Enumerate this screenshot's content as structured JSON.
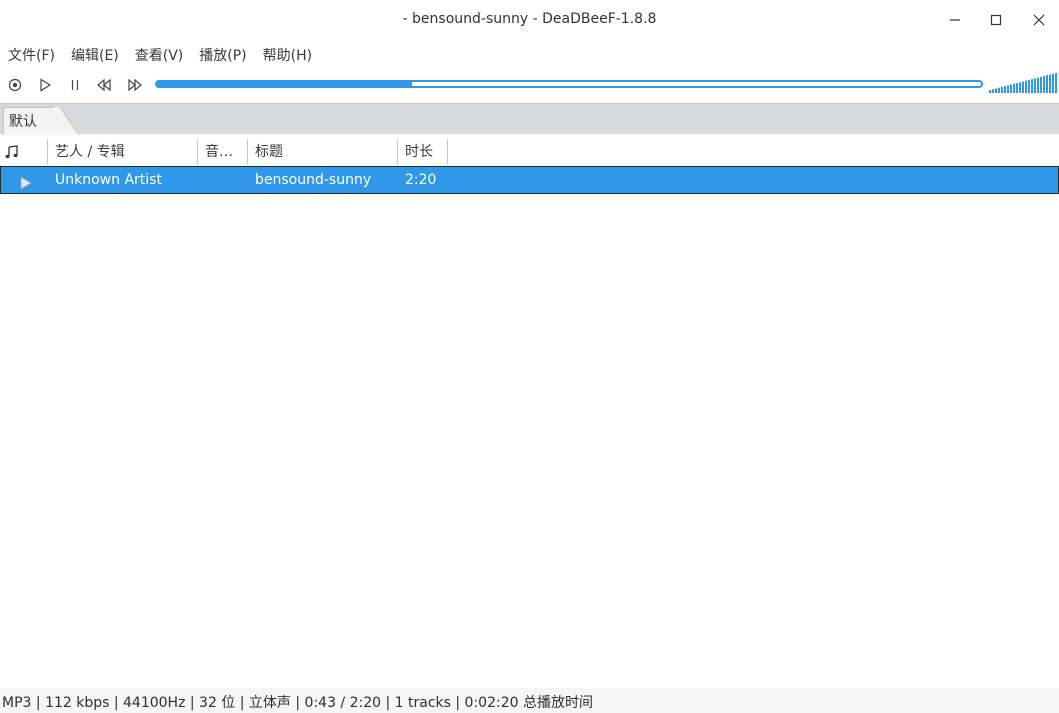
{
  "window": {
    "title": "- bensound-sunny - DeaDBeeF-1.8.8"
  },
  "menu": [
    {
      "label": "文件(F)"
    },
    {
      "label": "编辑(E)"
    },
    {
      "label": "查看(V)"
    },
    {
      "label": "播放(P)"
    },
    {
      "label": "帮助(H)"
    }
  ],
  "playback": {
    "progress_fraction": 0.31,
    "volume_fraction": 1.0
  },
  "tabs": [
    {
      "label": "默认"
    }
  ],
  "columns": [
    {
      "label": ""
    },
    {
      "label": "艺人 / 专辑"
    },
    {
      "label": "音…"
    },
    {
      "label": "标题"
    },
    {
      "label": "时长"
    }
  ],
  "tracks": [
    {
      "artist": "Unknown Artist",
      "title": "bensound-sunny",
      "duration": "2:20"
    }
  ],
  "status": {
    "text": "MP3 | 112 kbps | 44100Hz | 32 位 | 立体声 | 0:43 / 2:20 | 1 tracks | 0:02:20 总播放时间"
  },
  "colors": {
    "accent": "#2f98e8",
    "tabstrip": "#d7d9db"
  },
  "icons": [
    "stop-icon",
    "play-icon",
    "pause-icon",
    "previous-icon",
    "next-icon",
    "minimize-icon",
    "maximize-icon",
    "close-icon",
    "music-note-icon",
    "playing-triangle-icon"
  ]
}
